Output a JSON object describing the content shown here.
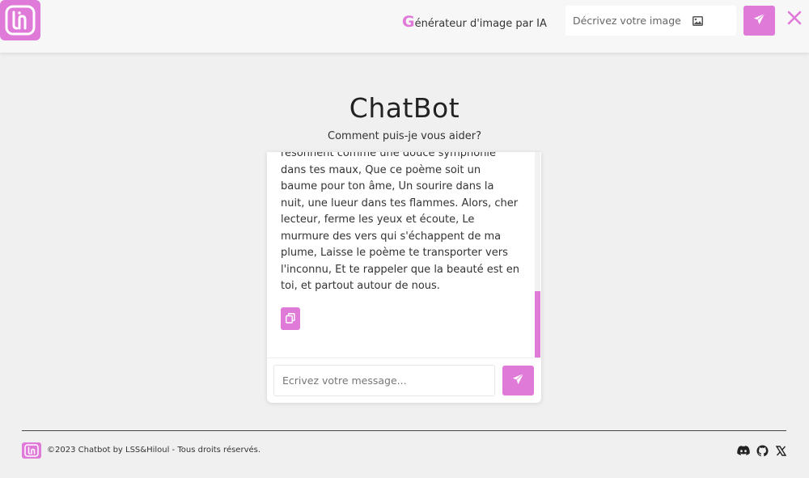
{
  "header": {
    "gen_title_initial": "G",
    "gen_title_rest": "énérateur d'image par IA",
    "image_input_placeholder": "Décrivez votre image",
    "logo_icon": "lh-logo-icon",
    "send_icon": "paper-plane-icon",
    "image_icon": "image-icon",
    "close_icon": "close-icon"
  },
  "main": {
    "title": "ChatBot",
    "subtitle": "Comment puis-je vous aider?"
  },
  "chat": {
    "message_text": "résonnent comme une douce symphonie dans tes maux, Que ce poème soit un baume pour ton âme, Un sourire dans la nuit, une lueur dans tes flammes. Alors, cher lecteur, ferme les yeux et écoute, Le murmure des vers qui s'échappent de ma plume, Laisse le poème te transporter vers l'inconnu, Et te rappeler que la beauté est en toi, et partout autour de nous.",
    "copy_icon": "copy-icon",
    "input_placeholder": "Ecrivez votre message...",
    "send_icon": "paper-plane-icon"
  },
  "footer": {
    "text": "©2023 Chatbot by LSS&Hiloul - Tous droits réservés.",
    "social_icons": [
      "discord-icon",
      "github-icon",
      "x-icon"
    ]
  },
  "colors": {
    "accent": "#e07ad8",
    "background": "#f0f0f0",
    "header_bg": "#f7f7f7"
  }
}
